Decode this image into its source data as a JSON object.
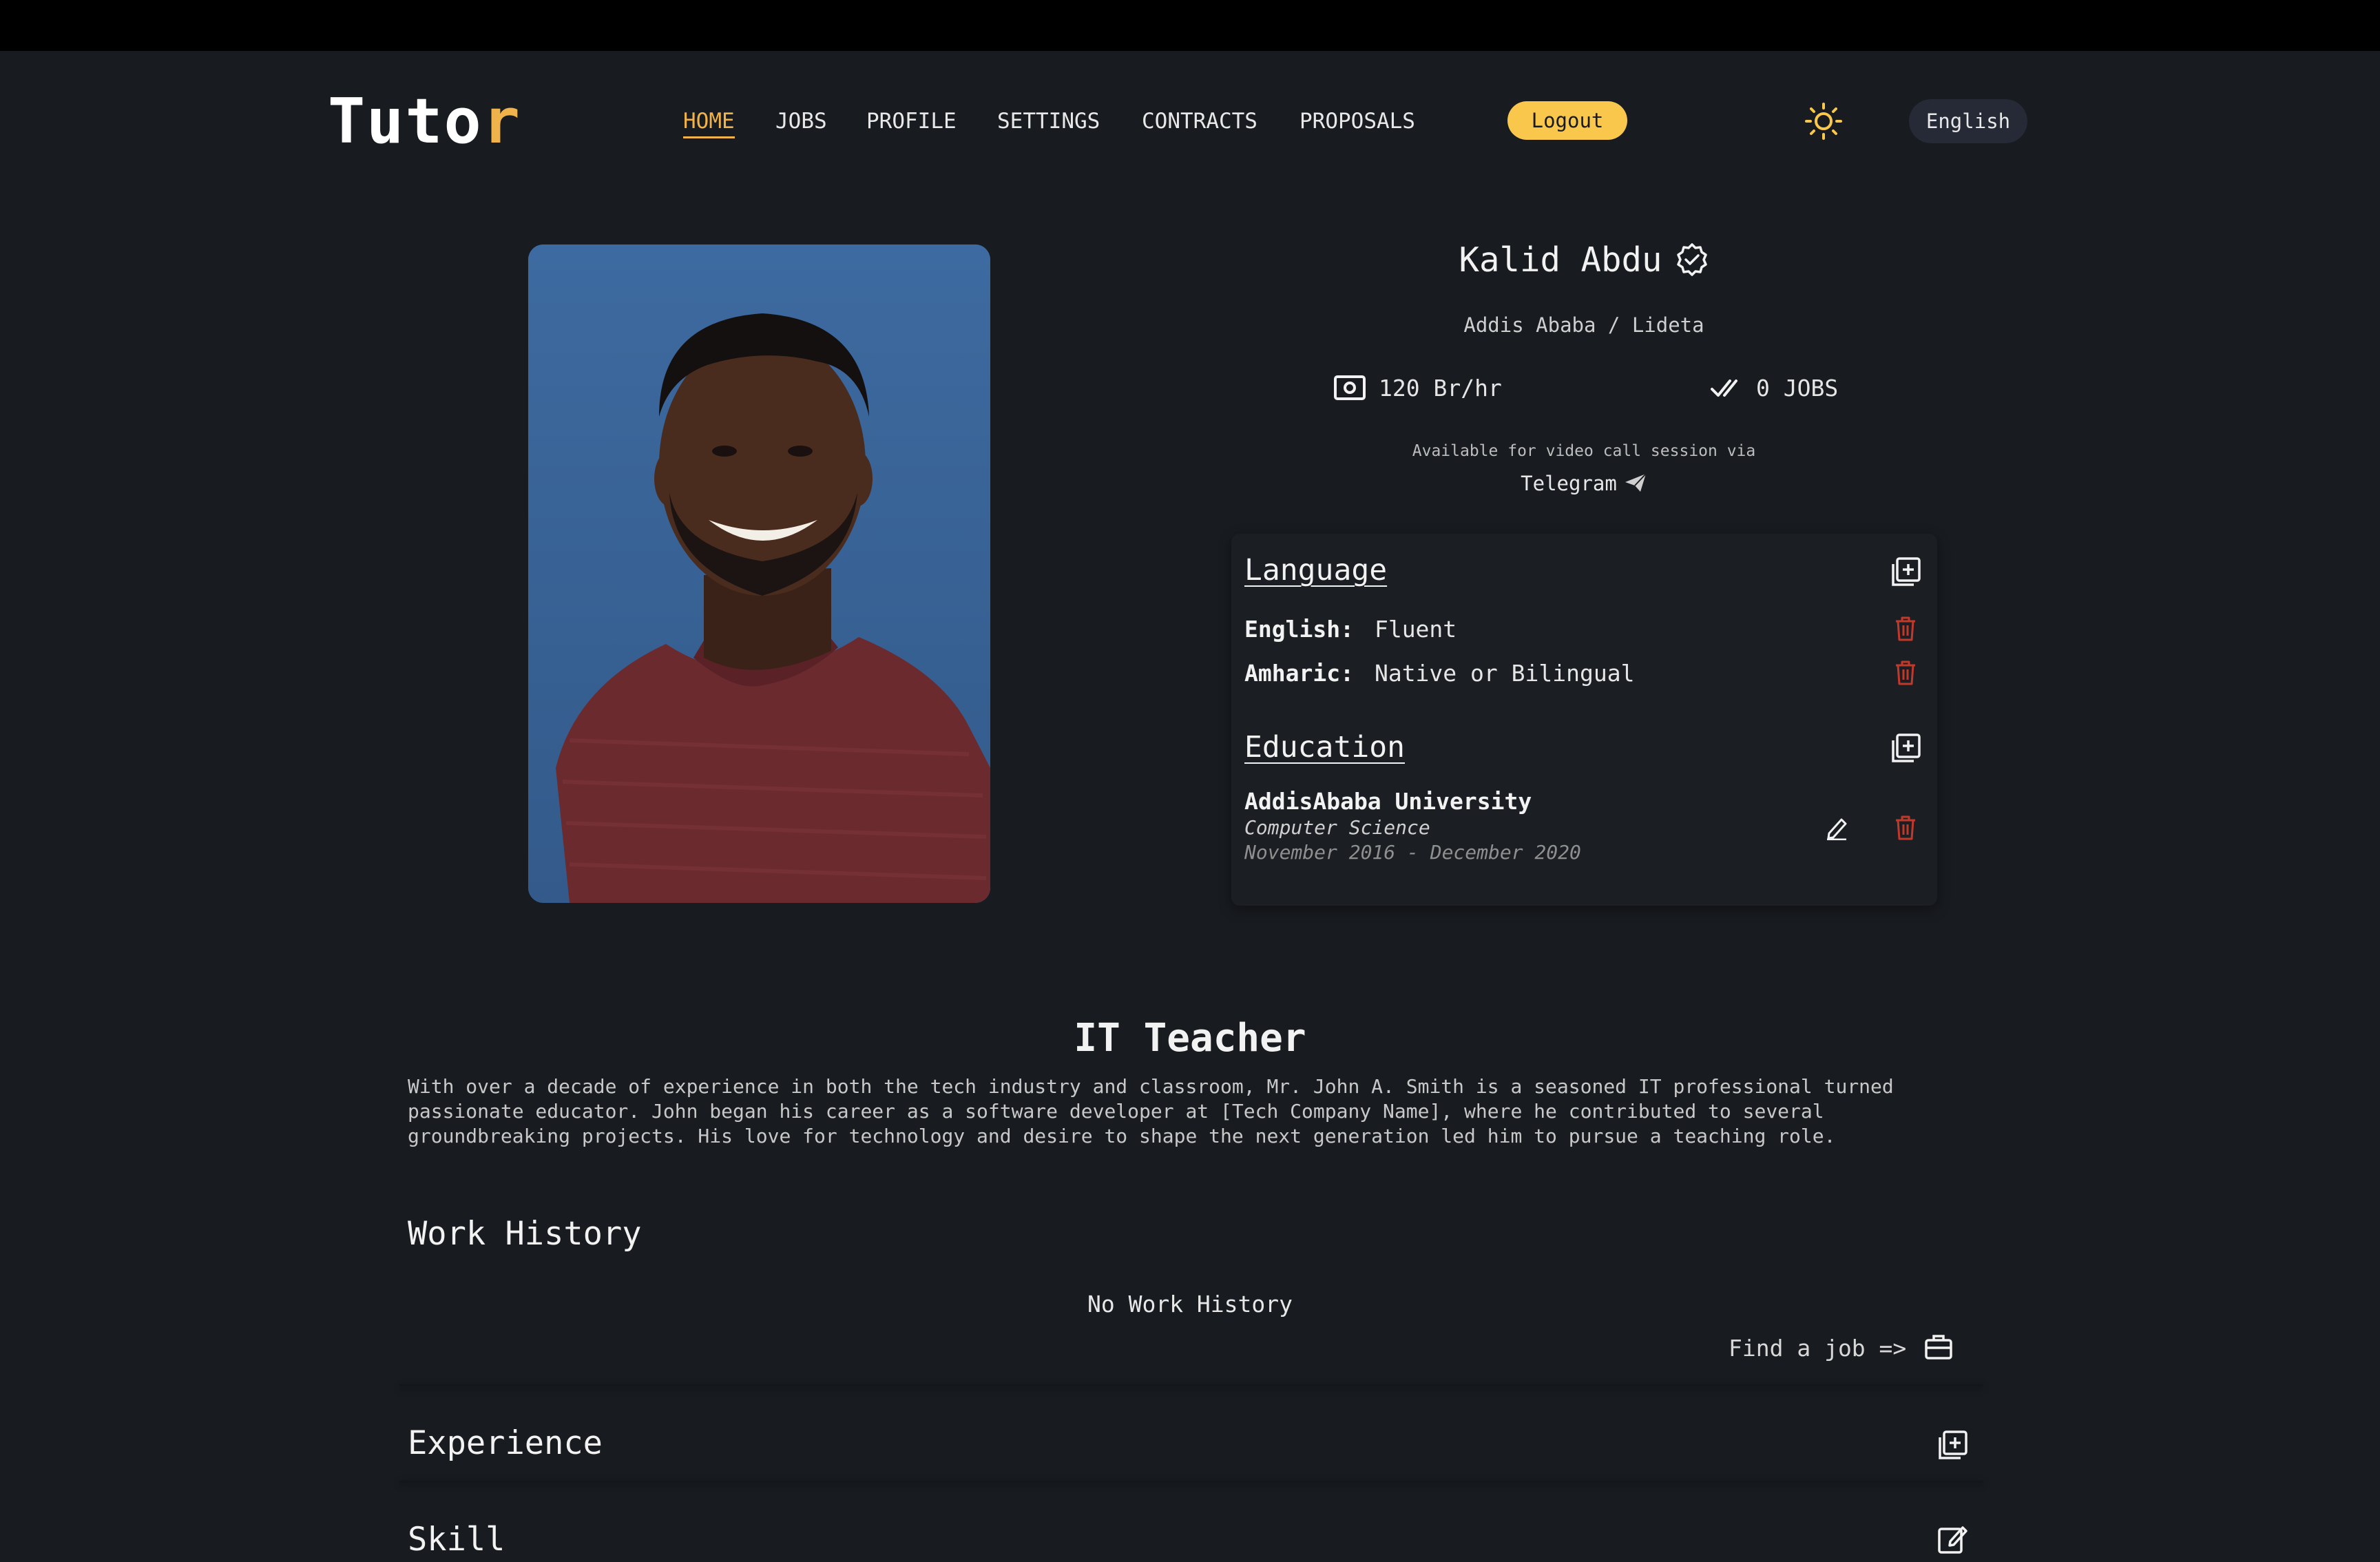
{
  "nav": {
    "logo_main": "Tuto",
    "logo_accent": "r",
    "links": [
      "HOME",
      "JOBS",
      "PROFILE",
      "SETTINGS",
      "CONTRACTS",
      "PROPOSALS"
    ],
    "active": "HOME",
    "logout_label": "Logout",
    "language_label": "English"
  },
  "colors": {
    "accent": "#f0b24a",
    "logout_bg": "#f8c74c",
    "danger": "#c0392b",
    "background": "#181b1f"
  },
  "profile": {
    "name": "Kalid Abdu",
    "location": "Addis Ababa / Lideta",
    "rate": "120 Br/hr",
    "jobs": "0 JOBS",
    "availability_note": "Available for video call session via",
    "call_platform": "Telegram"
  },
  "language": {
    "title": "Language",
    "items": [
      {
        "name": "English:",
        "level": "Fluent"
      },
      {
        "name": "Amharic:",
        "level": "Native or Bilingual"
      }
    ]
  },
  "education": {
    "title": "Education",
    "items": [
      {
        "school": "AddisAbaba University",
        "field": "Computer Science",
        "dates": "November 2016 - December 2020"
      }
    ]
  },
  "headline": "IT Teacher",
  "bio": "With over a decade of experience in both the tech industry and classroom, Mr. John A. Smith is a seasoned IT professional turned passionate educator. John began his career as a software developer at [Tech Company Name], where he contributed to several groundbreaking projects. His love for technology and desire to shape the next generation led him to pursue a teaching role.",
  "work_history": {
    "title": "Work History",
    "empty_text": "No Work History",
    "find_job_label": "Find a job =>"
  },
  "experience": {
    "title": "Experience"
  },
  "skills": {
    "title": "Skill"
  },
  "icons": [
    "sun-icon",
    "verified-badge-icon",
    "money-icon",
    "double-check-icon",
    "send-icon",
    "add-square-icon",
    "trash-icon",
    "pencil-icon",
    "briefcase-icon"
  ]
}
